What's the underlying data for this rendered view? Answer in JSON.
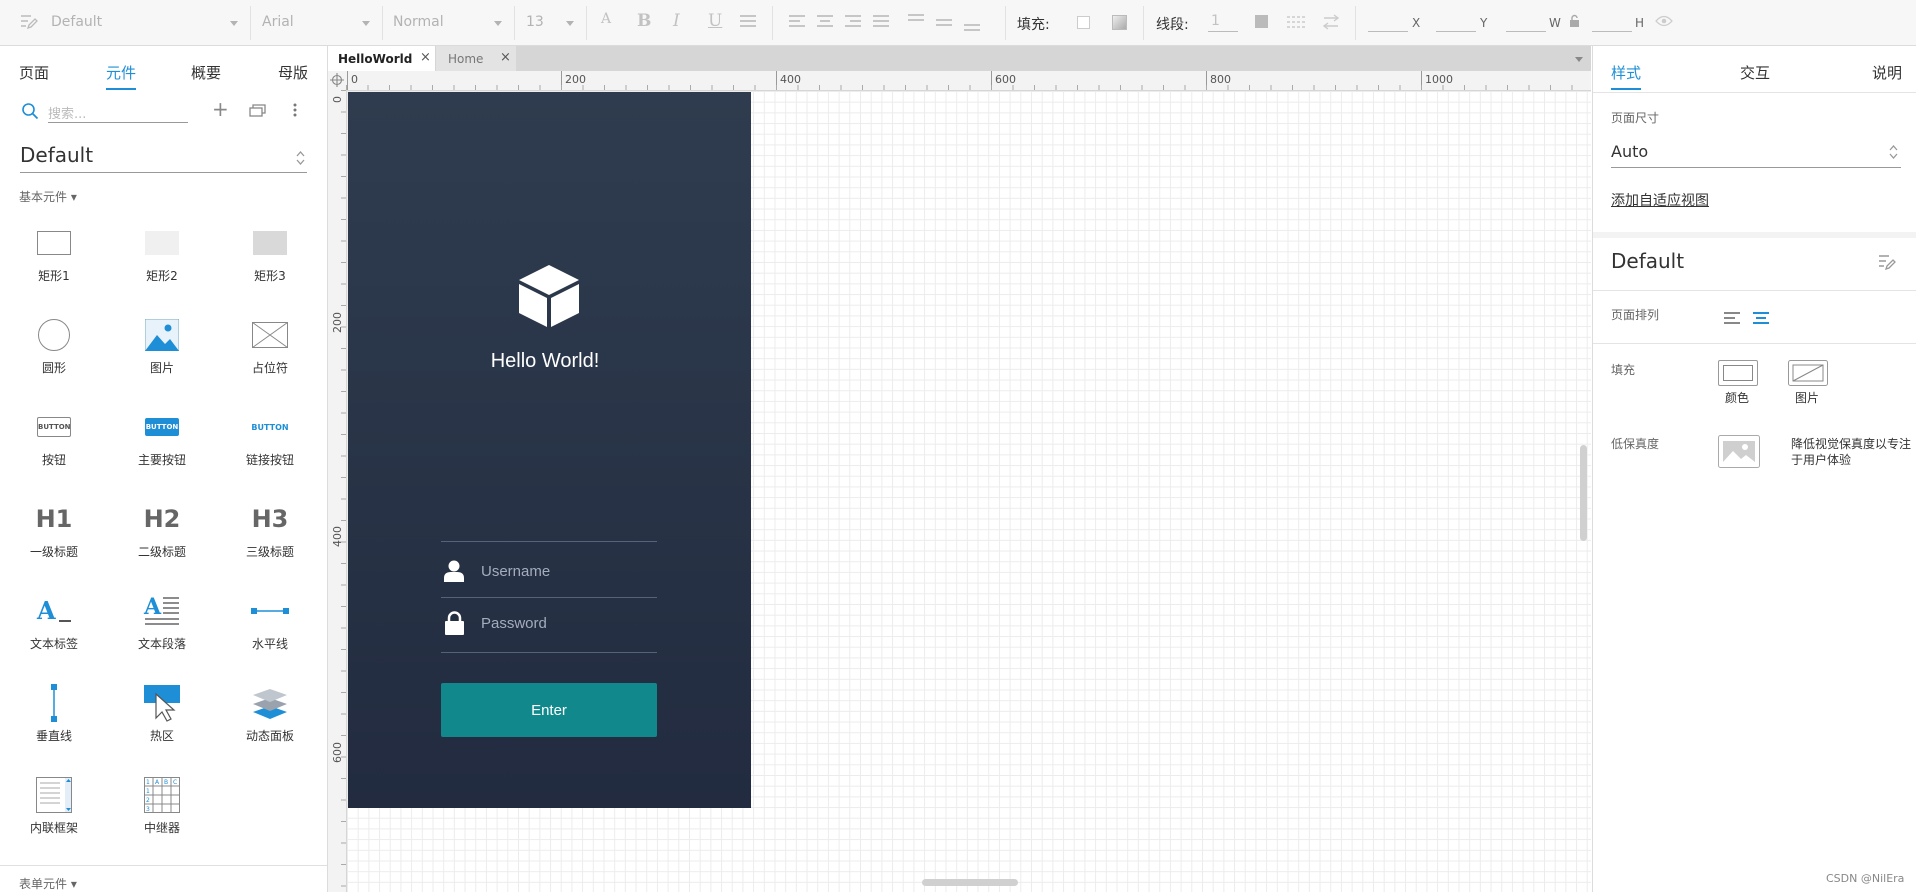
{
  "toolbar": {
    "style_name": "Default",
    "font_family": "Arial",
    "font_weight": "Normal",
    "font_size": "13",
    "fill_label": "填充:",
    "stroke_label": "线段:",
    "stroke_value": "1",
    "x_label": "X",
    "y_label": "Y",
    "w_label": "W",
    "h_label": "H"
  },
  "left_panel": {
    "tabs": [
      "页面",
      "元件",
      "概要",
      "母版"
    ],
    "active_tab": "元件",
    "search_placeholder": "搜索...",
    "library_name": "Default",
    "section_basic": "基本元件 ▾",
    "section_form": "表单元件 ▾",
    "widgets": [
      {
        "label": "矩形1",
        "icon": "rectangle-outline-icon"
      },
      {
        "label": "矩形2",
        "icon": "rectangle-light-icon"
      },
      {
        "label": "矩形3",
        "icon": "rectangle-gray-icon"
      },
      {
        "label": "圆形",
        "icon": "circle-icon"
      },
      {
        "label": "图片",
        "icon": "image-icon"
      },
      {
        "label": "占位符",
        "icon": "placeholder-icon"
      },
      {
        "label": "按钮",
        "icon": "button-icon",
        "text": "BUTTON"
      },
      {
        "label": "主要按钮",
        "icon": "primary-button-icon",
        "text": "BUTTON"
      },
      {
        "label": "链接按钮",
        "icon": "link-button-icon",
        "text": "BUTTON"
      },
      {
        "label": "一级标题",
        "icon": "h1-icon",
        "text": "H1"
      },
      {
        "label": "二级标题",
        "icon": "h2-icon",
        "text": "H2"
      },
      {
        "label": "三级标题",
        "icon": "h3-icon",
        "text": "H3"
      },
      {
        "label": "文本标签",
        "icon": "text-label-icon"
      },
      {
        "label": "文本段落",
        "icon": "text-paragraph-icon"
      },
      {
        "label": "水平线",
        "icon": "horizontal-line-icon"
      },
      {
        "label": "垂直线",
        "icon": "vertical-line-icon"
      },
      {
        "label": "热区",
        "icon": "hotspot-icon"
      },
      {
        "label": "动态面板",
        "icon": "dynamic-panel-icon"
      },
      {
        "label": "内联框架",
        "icon": "inline-frame-icon"
      },
      {
        "label": "中继器",
        "icon": "repeater-icon"
      }
    ]
  },
  "doc_tabs": [
    {
      "label": "HelloWorld",
      "active": true
    },
    {
      "label": "Home",
      "active": false
    }
  ],
  "ruler": {
    "h_labels": [
      "0",
      "200",
      "400",
      "600",
      "800",
      "1000"
    ],
    "v_labels": [
      "0",
      "200",
      "400",
      "600"
    ]
  },
  "prototype": {
    "title": "Hello World!",
    "username_placeholder": "Username",
    "password_placeholder": "Password",
    "enter_label": "Enter",
    "accent": "#11898c",
    "background": "#27324a"
  },
  "right_panel": {
    "tabs": [
      "样式",
      "交互",
      "说明"
    ],
    "active_tab": "样式",
    "page_size_label": "页面尺寸",
    "page_size_value": "Auto",
    "adaptive_link": "添加自适应视图",
    "style_name": "Default",
    "page_align_label": "页面排列",
    "fill_label": "填充",
    "fill_color": "颜色",
    "fill_image": "图片",
    "low_fidelity_label": "低保真度",
    "low_fidelity_desc": "降低视觉保真度以专注于用户体验"
  },
  "watermark": "CSDN @NilEra"
}
